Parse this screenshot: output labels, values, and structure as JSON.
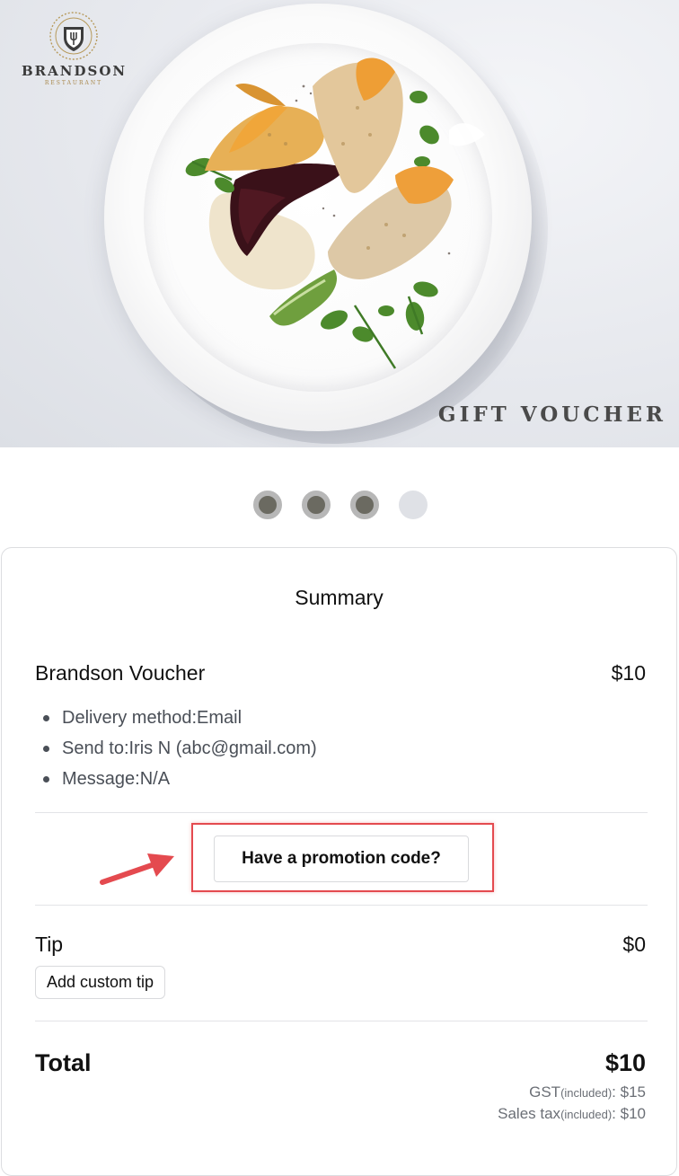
{
  "brand": {
    "name": "BRANDSON",
    "subtitle": "RESTAURANT"
  },
  "hero": {
    "caption": "GIFT VOUCHER"
  },
  "carousel": {
    "dots": [
      {
        "state": "filled"
      },
      {
        "state": "filled"
      },
      {
        "state": "filled"
      },
      {
        "state": "empty"
      }
    ]
  },
  "summary": {
    "title": "Summary",
    "item": {
      "name": "Brandson Voucher",
      "price": "$10",
      "details": [
        "Delivery method:Email",
        "Send to:Iris N (abc@gmail.com)",
        "Message:N/A"
      ]
    },
    "promo_button_label": "Have a promotion code?",
    "tip": {
      "label": "Tip",
      "value": "$0",
      "custom_button_label": "Add custom tip"
    },
    "total": {
      "label": "Total",
      "value": "$10"
    },
    "taxes": [
      {
        "label": "GST",
        "note": "(included)",
        "sep": ":",
        "value": "$15"
      },
      {
        "label": "Sales tax",
        "note": "(included)",
        "sep": ":",
        "value": "$10"
      }
    ]
  },
  "colors": {
    "highlight": "#e44a4f",
    "dot_filled": "#6b6a61",
    "dot_empty": "#dfe1e6"
  }
}
